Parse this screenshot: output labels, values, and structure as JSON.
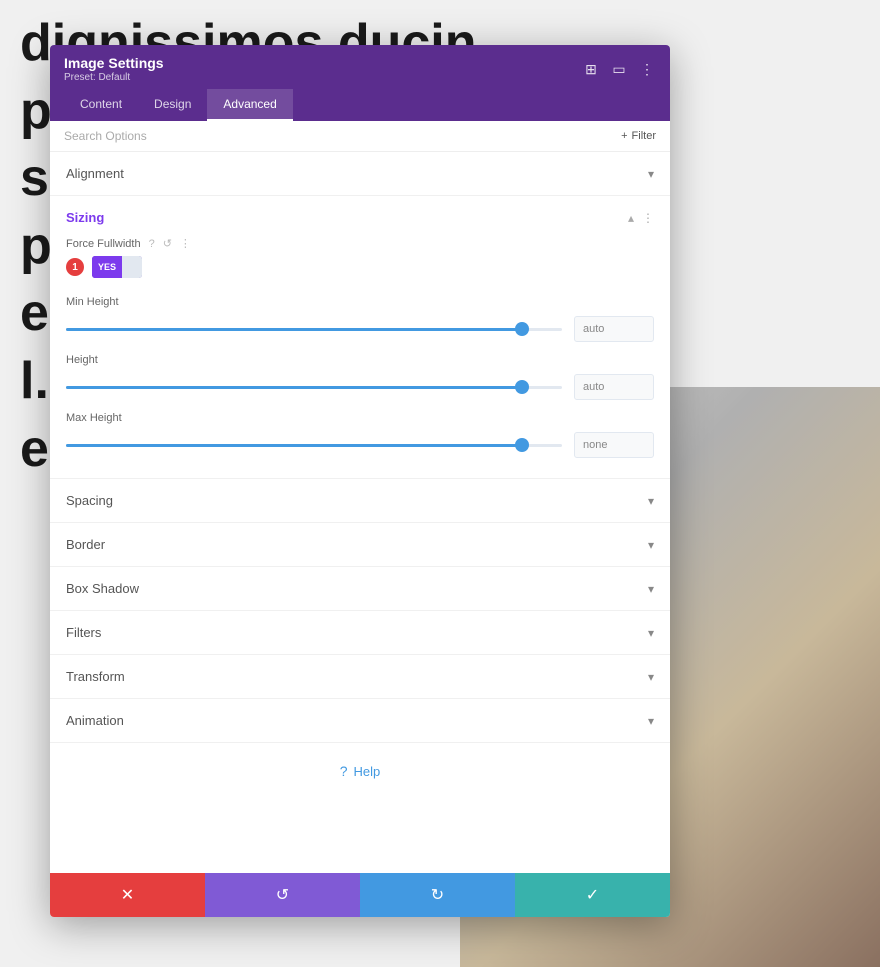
{
  "background": {
    "text_lines": [
      "dignissimos ducin",
      "ptatum deler",
      "s molestias ex",
      "provident, sin",
      "erunt mollitia d",
      "l. Et harum qu",
      "edita distinctio"
    ]
  },
  "modal": {
    "title": "Image Settings",
    "preset": "Preset: Default",
    "header_icons": [
      "expand",
      "columns",
      "more"
    ],
    "tabs": [
      {
        "label": "Content",
        "active": false
      },
      {
        "label": "Design",
        "active": false
      },
      {
        "label": "Advanced",
        "active": true
      }
    ],
    "search": {
      "placeholder": "Search Options",
      "filter_label": "Filter"
    },
    "sections": {
      "alignment": {
        "label": "Alignment",
        "collapsed": true
      },
      "sizing": {
        "label": "Sizing",
        "open": true,
        "force_fullwidth": {
          "label": "Force Fullwidth",
          "toggle_yes": "YES",
          "toggle_no": "",
          "step_number": "1"
        },
        "min_height": {
          "label": "Min Height",
          "value": "auto",
          "fill_pct": 92
        },
        "height": {
          "label": "Height",
          "value": "auto",
          "fill_pct": 92
        },
        "max_height": {
          "label": "Max Height",
          "value": "none",
          "fill_pct": 92
        }
      },
      "spacing": {
        "label": "Spacing",
        "collapsed": true
      },
      "border": {
        "label": "Border",
        "collapsed": true
      },
      "box_shadow": {
        "label": "Box Shadow",
        "collapsed": true
      },
      "filters": {
        "label": "Filters",
        "collapsed": true
      },
      "transform": {
        "label": "Transform",
        "collapsed": true
      },
      "animation": {
        "label": "Animation",
        "collapsed": true
      }
    },
    "help": {
      "label": "Help"
    },
    "footer": {
      "cancel_icon": "✕",
      "reset_icon": "↺",
      "redo_icon": "↻",
      "save_icon": "✓"
    }
  },
  "colors": {
    "purple_header": "#5b2d8e",
    "purple_accent": "#7c3aed",
    "blue_slider": "#4299e1",
    "red_cancel": "#e53e3e",
    "teal_save": "#38b2ac"
  }
}
